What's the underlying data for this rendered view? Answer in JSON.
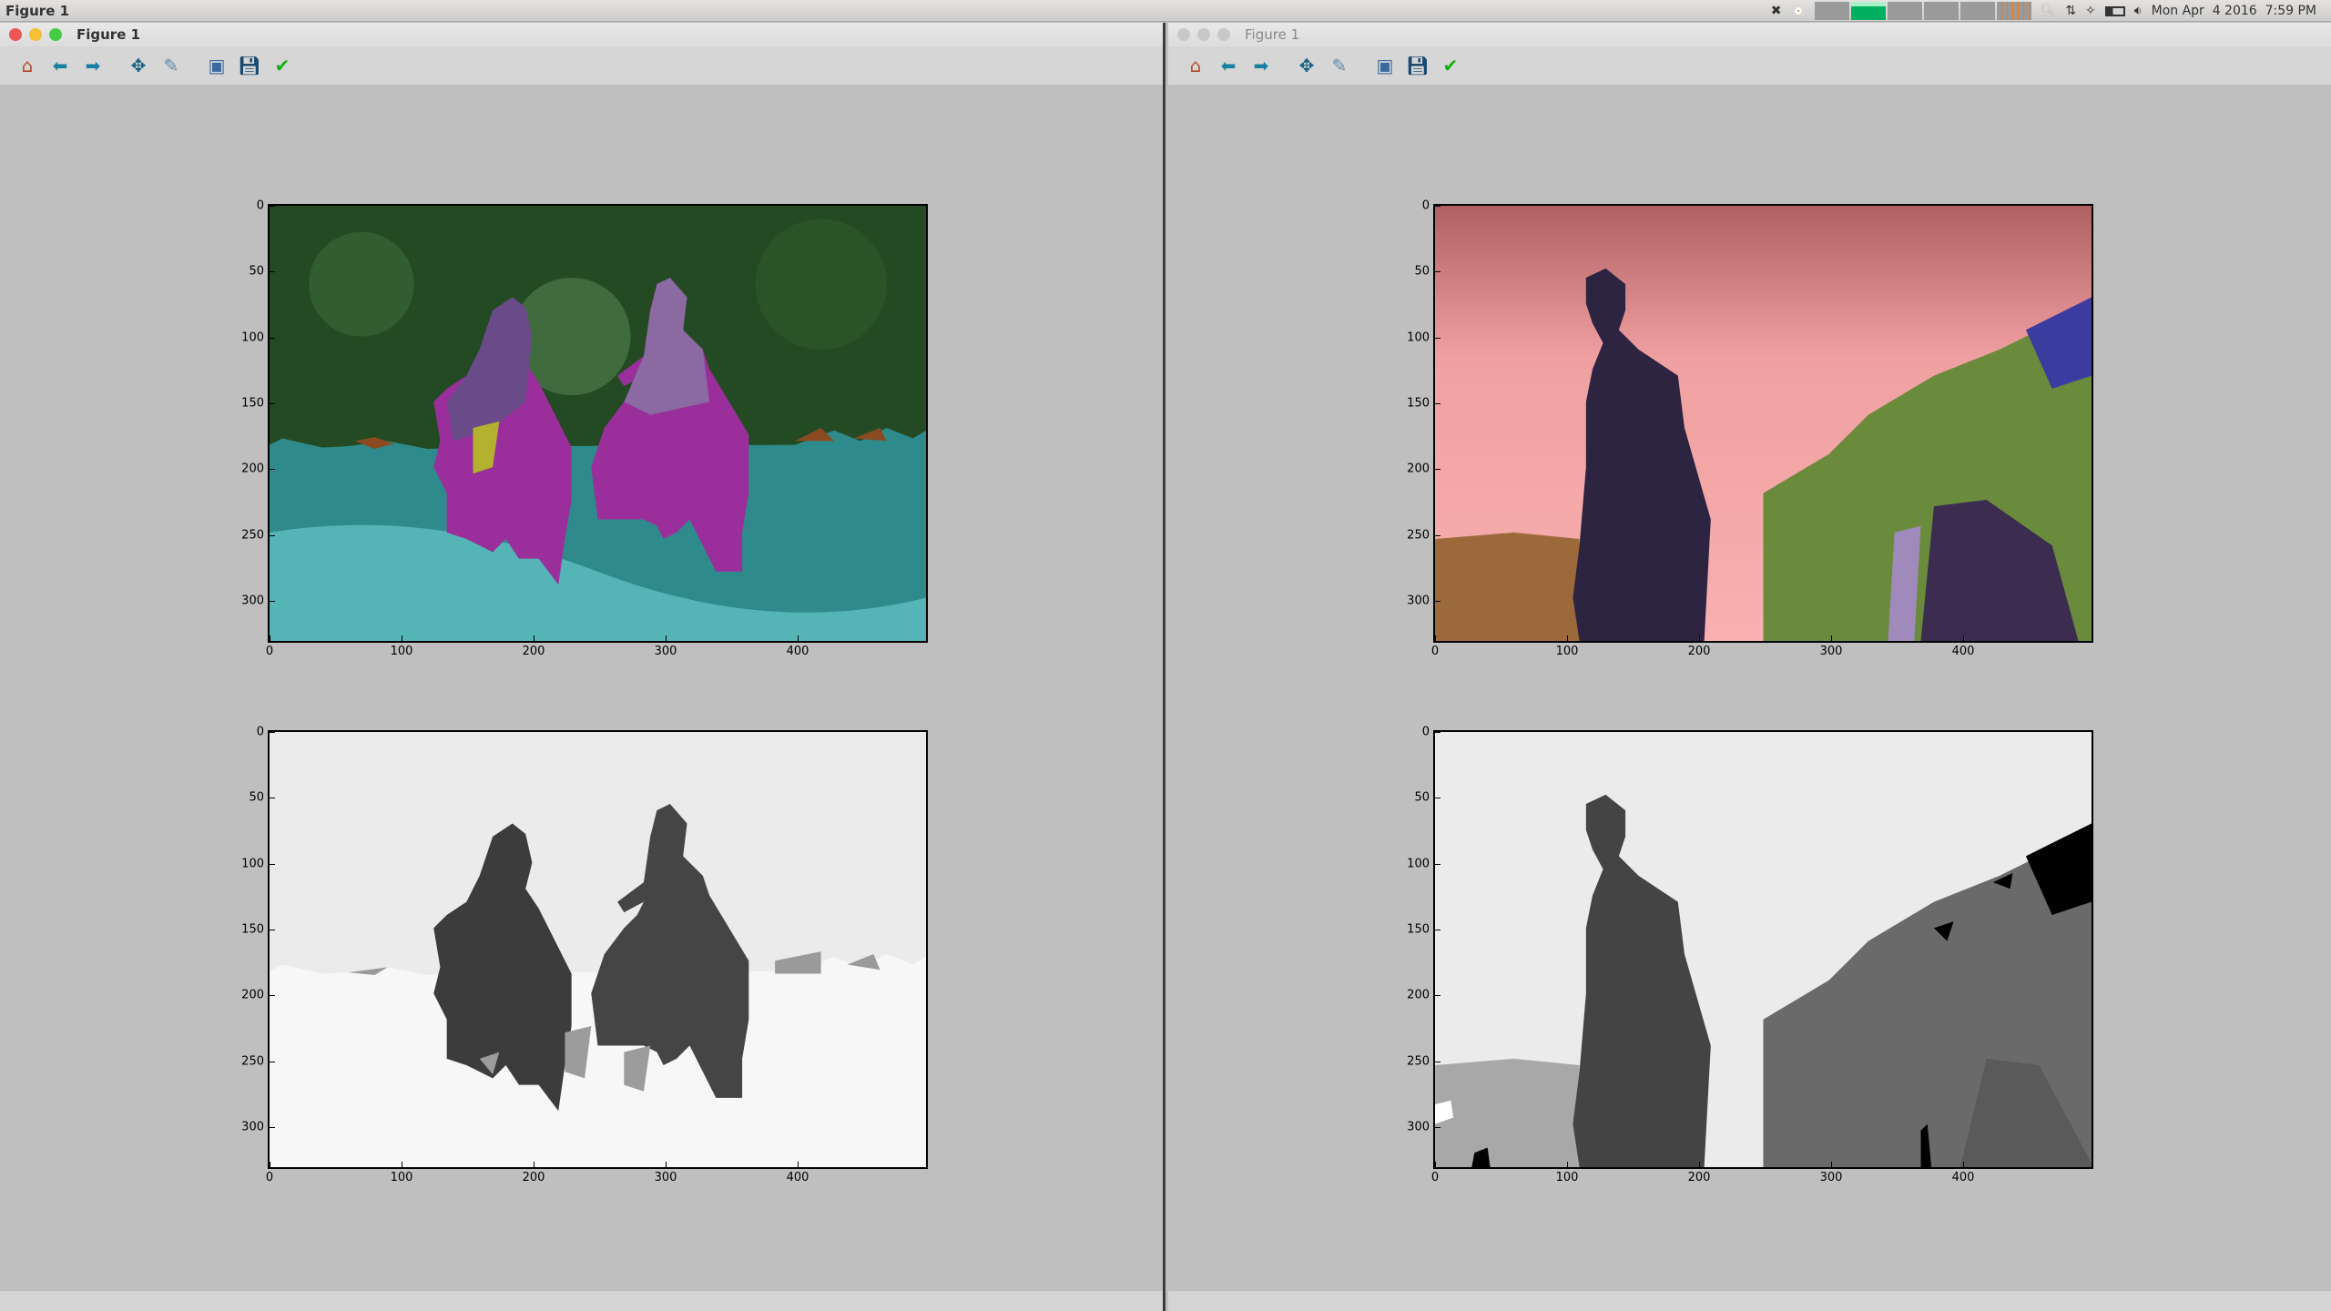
{
  "topbar": {
    "app_name": "Figure 1",
    "clock": "Mon Apr  4 2016  7:59 PM",
    "tray_icons": [
      "dropbox-icon",
      "chrome-icon",
      "system-monitor-graphs",
      "search-icon",
      "network-icon",
      "bluetooth-icon",
      "battery-icon",
      "volume-icon",
      "apple-icon"
    ]
  },
  "windows": [
    {
      "title": "Figure 1",
      "active": true
    },
    {
      "title": "Figure 1",
      "active": false
    }
  ],
  "toolbar": {
    "buttons": [
      "home",
      "back",
      "forward",
      "pan",
      "zoom",
      "configure-subplots",
      "save",
      "edit"
    ]
  },
  "axes": {
    "y_ticks": [
      "0",
      "50",
      "100",
      "150",
      "200",
      "250",
      "300"
    ],
    "x_ticks": [
      "0",
      "100",
      "200",
      "300",
      "400"
    ],
    "y_tick_values": [
      0,
      50,
      100,
      150,
      200,
      250,
      300
    ],
    "x_tick_values": [
      0,
      100,
      200,
      300,
      400
    ],
    "xlim": [
      0,
      500
    ],
    "ylim": [
      333,
      0
    ]
  },
  "colors": {
    "window_bg": "#bfbfbf",
    "close": "#ee5555",
    "minimize": "#f5c033",
    "maximize": "#44cc44"
  }
}
